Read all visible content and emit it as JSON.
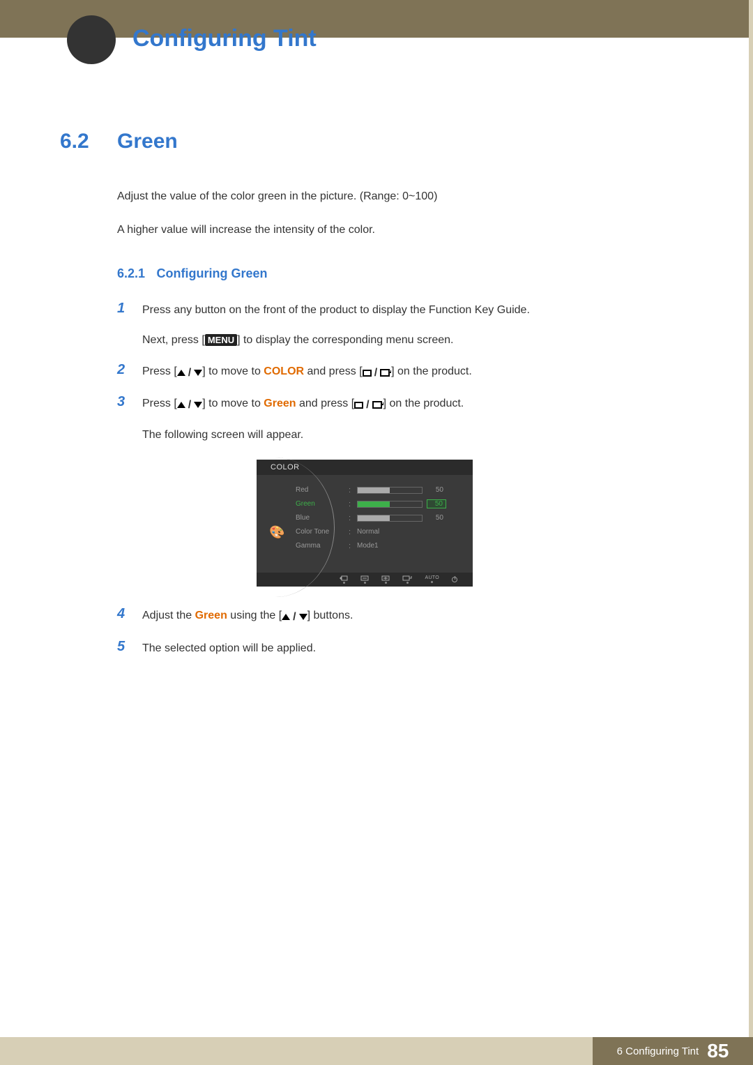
{
  "chapter_title": "Configuring Tint",
  "chapter_number": "6",
  "section": {
    "num": "6.2",
    "title": "Green"
  },
  "intro": {
    "p1": "Adjust the value of the color green in the picture. (Range: 0~100)",
    "p2": "A higher value will increase the intensity of the color."
  },
  "subsection": {
    "num": "6.2.1",
    "title": "Configuring Green"
  },
  "steps": {
    "s1": {
      "num": "1",
      "text_a": "Press any button on the front of the product to display the Function Key Guide.",
      "text_b_pre": "Next, press [",
      "menu_label": "MENU",
      "text_b_post": "] to display the corresponding menu screen."
    },
    "s2": {
      "num": "2",
      "pre": "Press [",
      "mid": "] to move to ",
      "kw": "COLOR",
      "after_kw": " and press [",
      "post": "] on the product."
    },
    "s3": {
      "num": "3",
      "pre": "Press [",
      "mid": "] to move to ",
      "kw": "Green",
      "after_kw": " and press [",
      "post": "] on the product.",
      "sub": "The following screen will appear."
    },
    "s4": {
      "num": "4",
      "pre": "Adjust the ",
      "kw": "Green",
      "mid": " using the [",
      "post": "] buttons."
    },
    "s5": {
      "num": "5",
      "text": "The selected option will be applied."
    }
  },
  "osd": {
    "header": "COLOR",
    "rows": {
      "red": {
        "label": "Red",
        "value": "50",
        "pct": 50
      },
      "green": {
        "label": "Green",
        "value": "50",
        "pct": 50,
        "selected": true
      },
      "blue": {
        "label": "Blue",
        "value": "50",
        "pct": 50
      },
      "tone": {
        "label": "Color Tone",
        "text": "Normal"
      },
      "gamma": {
        "label": "Gamma",
        "text": "Mode1"
      }
    },
    "footer_auto": "AUTO"
  },
  "footer": {
    "chapter_ref": "6 Configuring Tint",
    "page": "85"
  }
}
